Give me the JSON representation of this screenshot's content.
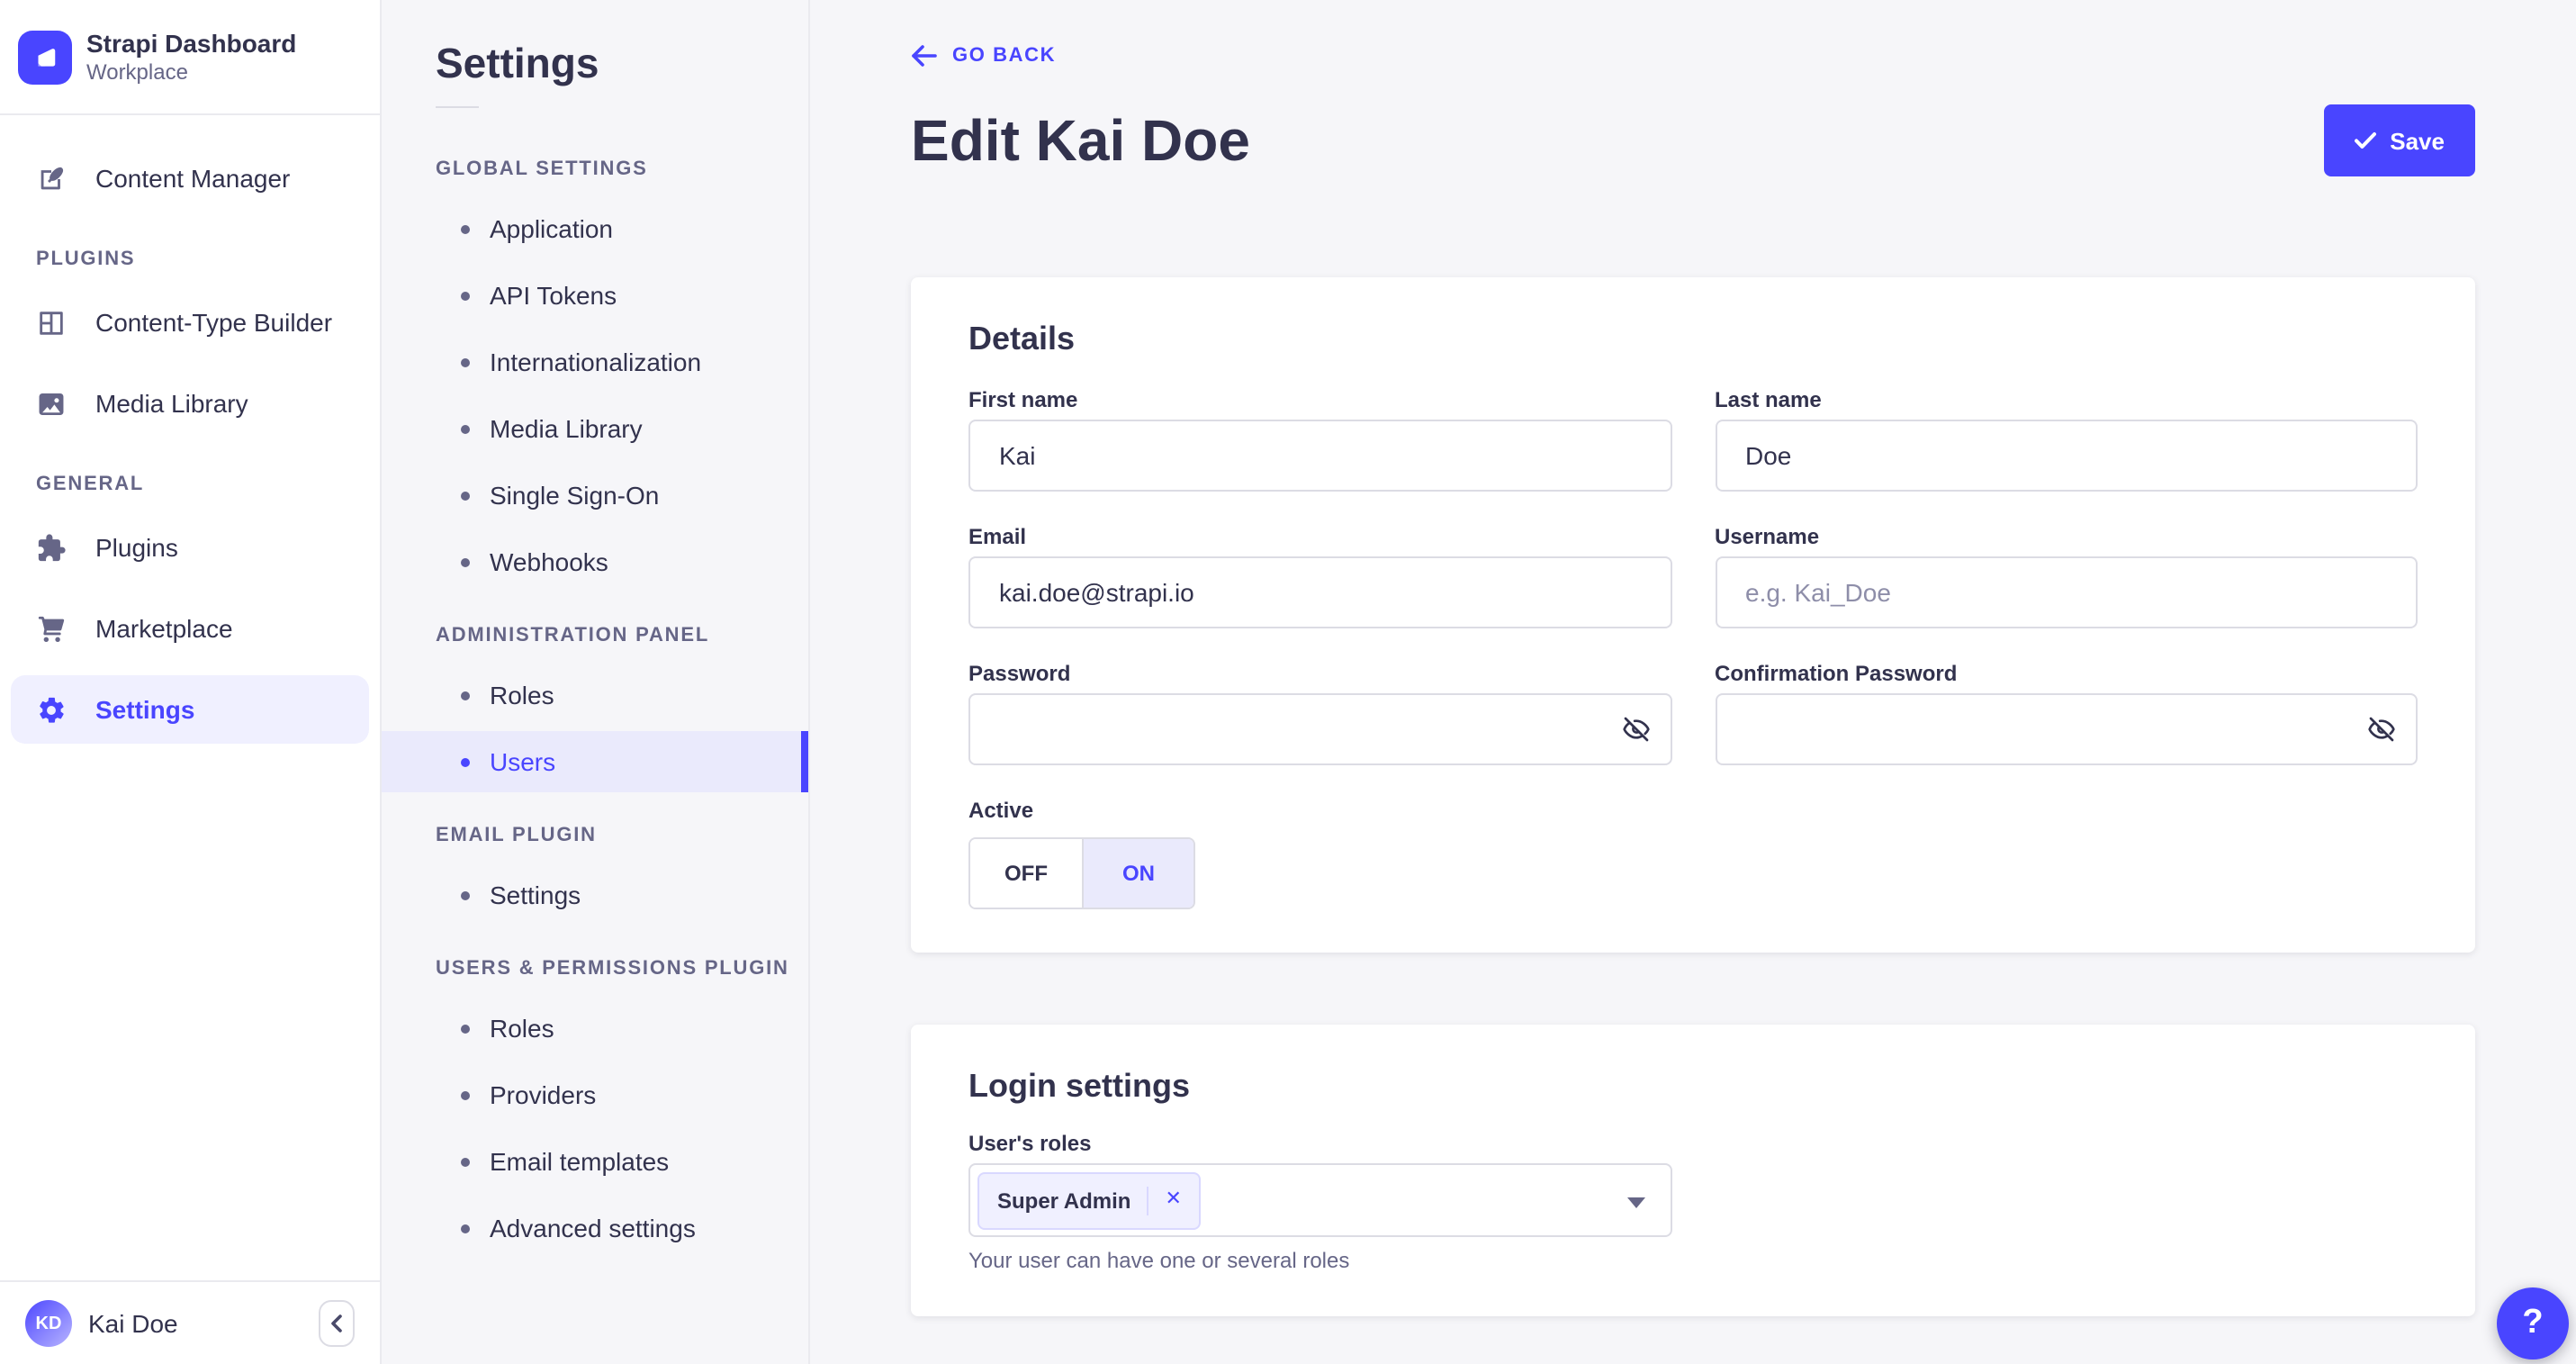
{
  "app": {
    "name": "Strapi Dashboard",
    "workspace": "Workplace"
  },
  "colors": {
    "accent": "#4945ff",
    "accent_light_bg": "#f0f0ff",
    "selected_row_bg": "#eaeafc",
    "text": "#32324d",
    "muted_text": "#666687",
    "border": "#eaeaef",
    "input_border": "#dcdce4",
    "page_bg": "#f6f6f9"
  },
  "sidebar": {
    "main_item": {
      "label": "Content Manager",
      "icon": "feather-icon"
    },
    "sections": [
      {
        "label": "PLUGINS",
        "items": [
          {
            "label": "Content-Type Builder",
            "icon": "layout-icon"
          },
          {
            "label": "Media Library",
            "icon": "image-icon"
          }
        ]
      },
      {
        "label": "GENERAL",
        "items": [
          {
            "label": "Plugins",
            "icon": "puzzle-icon"
          },
          {
            "label": "Marketplace",
            "icon": "cart-icon"
          },
          {
            "label": "Settings",
            "icon": "gear-icon",
            "active": true
          }
        ]
      }
    ],
    "user": {
      "name": "Kai Doe",
      "initials": "KD"
    }
  },
  "subnav": {
    "title": "Settings",
    "sections": [
      {
        "label": "GLOBAL SETTINGS",
        "items": [
          "Application",
          "API Tokens",
          "Internationalization",
          "Media Library",
          "Single Sign-On",
          "Webhooks"
        ]
      },
      {
        "label": "ADMINISTRATION PANEL",
        "items": [
          "Roles",
          "Users"
        ],
        "active_item": "Users"
      },
      {
        "label": "EMAIL PLUGIN",
        "items": [
          "Settings"
        ]
      },
      {
        "label": "USERS & PERMISSIONS PLUGIN",
        "items": [
          "Roles",
          "Providers",
          "Email templates",
          "Advanced settings"
        ]
      }
    ]
  },
  "header": {
    "back_label": "GO BACK",
    "title": "Edit Kai Doe",
    "save_label": "Save"
  },
  "details_card": {
    "title": "Details",
    "fields": {
      "first_name": {
        "label": "First name",
        "value": "Kai"
      },
      "last_name": {
        "label": "Last name",
        "value": "Doe"
      },
      "email": {
        "label": "Email",
        "value": "kai.doe@strapi.io"
      },
      "username": {
        "label": "Username",
        "placeholder": "e.g. Kai_Doe"
      },
      "password": {
        "label": "Password"
      },
      "confirm_password": {
        "label": "Confirmation Password"
      },
      "active": {
        "label": "Active",
        "off": "OFF",
        "on": "ON",
        "value": "ON"
      }
    }
  },
  "login_card": {
    "title": "Login settings",
    "roles_label": "User's roles",
    "selected_roles": [
      "Super Admin"
    ],
    "remove_label": "✕",
    "helper": "Your user can have one or several roles"
  },
  "help": {
    "label": "?"
  }
}
